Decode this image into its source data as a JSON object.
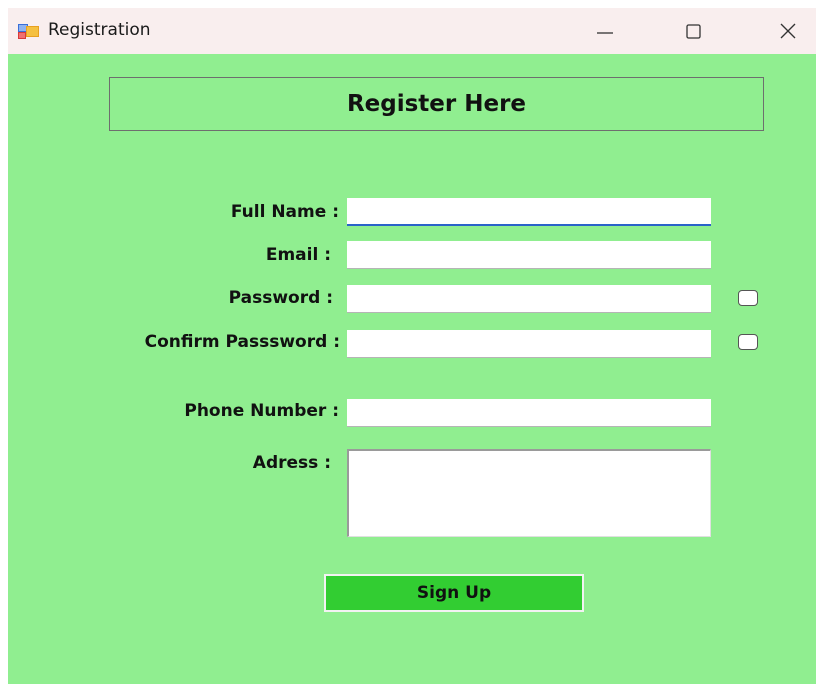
{
  "window": {
    "title": "Registration",
    "icon": "app-form-icon",
    "controls": [
      "minimize-icon",
      "maximize-icon",
      "close-icon"
    ]
  },
  "header": {
    "title": "Register Here"
  },
  "form": {
    "full_name": {
      "label": "Full Name :",
      "value": ""
    },
    "email": {
      "label": "Email :",
      "value": ""
    },
    "password": {
      "label": "Password :",
      "value": ""
    },
    "confirm_password": {
      "label": "Confirm Passsword :",
      "value": ""
    },
    "phone": {
      "label": "Phone Number :",
      "value": ""
    },
    "address": {
      "label": "Adress :",
      "value": ""
    },
    "signup_label": "Sign Up"
  },
  "colors": {
    "background": "#90ee90",
    "titlebar": "#f9eeee",
    "signup_button": "#32cd32",
    "focus_underline": "#2a63c9"
  }
}
